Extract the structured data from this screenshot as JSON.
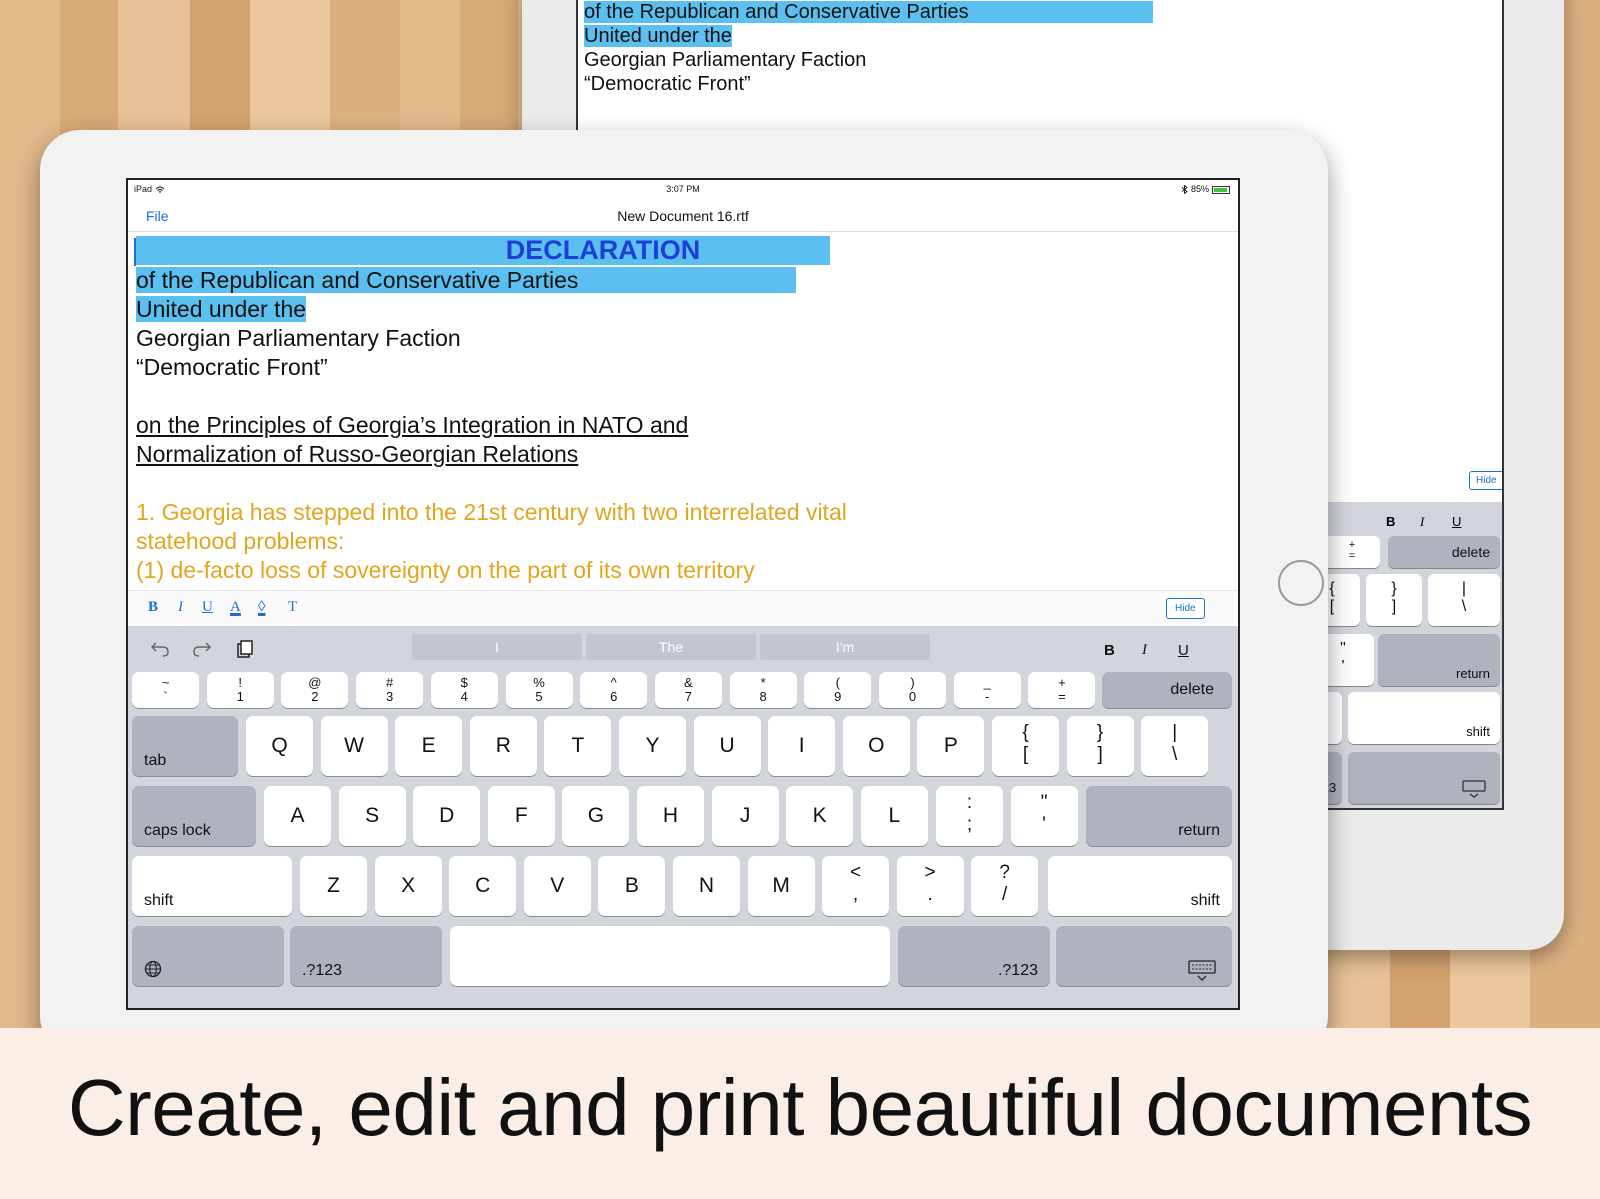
{
  "caption": "Create, edit and print beautiful documents",
  "back_device": {
    "doc_lines": [
      "of the Republican and Conservative Parties",
      "United under the",
      "Georgian Parliamentary Faction",
      "“Democratic Front”"
    ],
    "hide_label": "Hide",
    "fmt": {
      "bold": "B",
      "italic": "I",
      "underline": "U"
    },
    "keys": {
      "plus_top": "+",
      "plus_bottom": "=",
      "delete": "delete",
      "brace_top": "{",
      "brace_bottom": "[",
      "close_brace_top": "}",
      "close_brace_bottom": "]",
      "pipe_top": "|",
      "pipe_bottom": "\\",
      "quote_top": "\"",
      "quote_bottom": "'",
      "return": "return",
      "question_top": "?",
      "question_bottom": "/",
      "shift": "shift",
      "numbers": ".?123"
    }
  },
  "status_bar": {
    "device": "iPad",
    "time": "3:07 PM",
    "battery": "85%"
  },
  "navbar": {
    "file": "File",
    "title": "New Document 16.rtf"
  },
  "document": {
    "heading": "DECLARATION",
    "line1": "of the Republican and Conservative Parties",
    "line2": "United under the",
    "line3": "Georgian Parliamentary Faction",
    "line4": "“Democratic Front”",
    "line5": "on the Principles of Georgia’s Integration in NATO and",
    "line6": "Normalization of Russo-Georgian Relations",
    "line7": "1. Georgia has stepped into the 21st century with two interrelated vital",
    "line8": "statehood problems:",
    "line9": "(1) de-facto loss of sovereignty on the part of its own territory"
  },
  "format_bar": {
    "bold": "B",
    "italic": "I",
    "underline": "U",
    "text_color": "A",
    "highlight": "◊",
    "font": "T",
    "hide": "Hide"
  },
  "keyboard": {
    "suggestions": [
      "I",
      "The",
      "I'm"
    ],
    "toolbar": {
      "bold": "B",
      "italic": "I",
      "underline": "U"
    },
    "number_row": [
      [
        "~",
        "`"
      ],
      [
        "!",
        "1"
      ],
      [
        "@",
        "2"
      ],
      [
        "#",
        "3"
      ],
      [
        "$",
        "4"
      ],
      [
        "%",
        "5"
      ],
      [
        "^",
        "6"
      ],
      [
        "&",
        "7"
      ],
      [
        "*",
        "8"
      ],
      [
        "(",
        "9"
      ],
      [
        ")",
        "0"
      ],
      [
        "_",
        "-"
      ],
      [
        "+",
        "="
      ]
    ],
    "delete": "delete",
    "tab": "tab",
    "row_q": [
      "Q",
      "W",
      "E",
      "R",
      "T",
      "Y",
      "U",
      "I",
      "O",
      "P"
    ],
    "row_q_sym": [
      [
        "{",
        "["
      ],
      [
        "}",
        "]"
      ],
      [
        "|",
        "\\"
      ]
    ],
    "caps_lock": "caps lock",
    "row_a": [
      "A",
      "S",
      "D",
      "F",
      "G",
      "H",
      "J",
      "K",
      "L"
    ],
    "row_a_sym": [
      [
        ":",
        ";"
      ],
      [
        "\"",
        "'"
      ]
    ],
    "return": "return",
    "shift": "shift",
    "row_z": [
      "Z",
      "X",
      "C",
      "V",
      "B",
      "N",
      "M"
    ],
    "row_z_sym": [
      [
        "<",
        ","
      ],
      [
        ">",
        "."
      ],
      [
        "?",
        "/"
      ]
    ],
    "numbers": ".?123"
  }
}
